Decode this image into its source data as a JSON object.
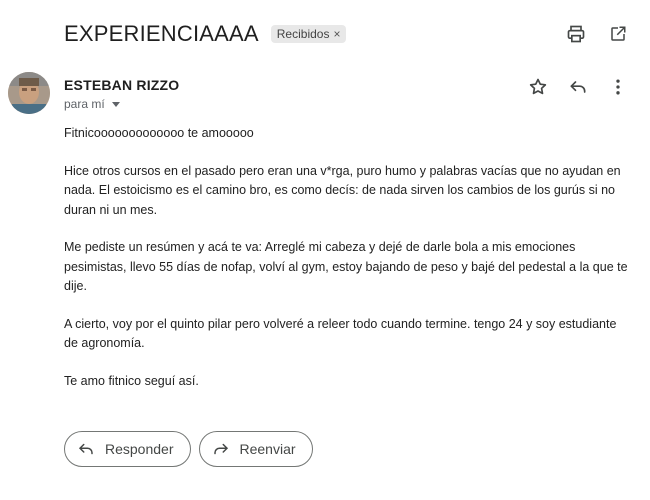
{
  "subject": "EXPERIENCIAAAA",
  "label": {
    "text": "Recibidos",
    "close": "×"
  },
  "sender": {
    "name": "ESTEBAN RIZZO",
    "recipient": "para mí"
  },
  "body": {
    "p1": "Fitnicooooooooooooo te amooooo",
    "p2": "Hice otros cursos en el pasado pero eran una v*rga, puro humo y palabras vacías que no ayudan en nada. El estoicismo es el camino bro, es como decís: de nada sirven los cambios de los gurús si no duran ni un mes.",
    "p3": "Me pediste un resúmen y acá te va: Arreglé mi cabeza y dejé de darle bola a mis emociones pesimistas, llevo 55 días de nofap, volví al gym, estoy bajando de peso y bajé del pedestal a la que te dije.",
    "p4": "A cierto, voy por el quinto pilar pero volveré a releer todo cuando termine. tengo 24 y soy estudiante de agronomía.",
    "p5": "Te amo fitnico seguí así."
  },
  "buttons": {
    "reply": "Responder",
    "forward": "Reenviar"
  },
  "icons": {
    "print": "print-icon",
    "open_new": "open-in-new-icon",
    "star": "star-icon",
    "reply": "reply-icon",
    "more": "more-vert-icon"
  }
}
